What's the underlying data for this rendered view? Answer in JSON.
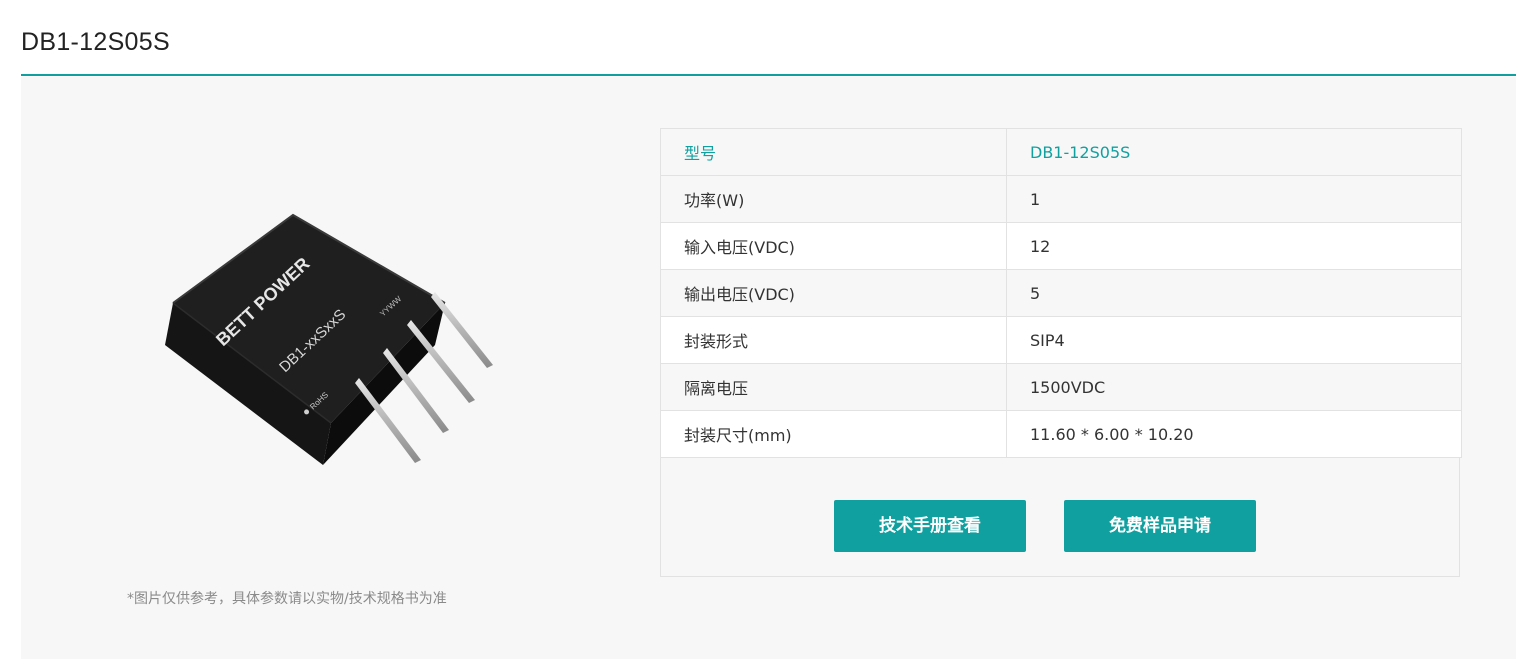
{
  "title": "DB1-12S05S",
  "image": {
    "brand_text": "BETT POWER",
    "model_text": "DB1-xxSxxS",
    "date_code": "YYWW",
    "rohs_text": "RoHS"
  },
  "caption": "*图片仅供参考，具体参数请以实物/技术规格书为准",
  "specs": {
    "rows": [
      {
        "key": "型号",
        "value": "DB1-12S05S"
      },
      {
        "key": "功率(W)",
        "value": "1"
      },
      {
        "key": "输入电压(VDC)",
        "value": "12"
      },
      {
        "key": "输出电压(VDC)",
        "value": "5"
      },
      {
        "key": "封装形式",
        "value": "SIP4"
      },
      {
        "key": "隔离电压",
        "value": "1500VDC"
      },
      {
        "key": "封装尺寸(mm)",
        "value": "11.60 * 6.00 * 10.20"
      }
    ]
  },
  "buttons": {
    "manual_label": "技术手册查看",
    "sample_label": "免费样品申请"
  },
  "colors": {
    "accent": "#11a0a0",
    "panel_bg": "#f7f7f7",
    "border": "#e2e2e2"
  }
}
